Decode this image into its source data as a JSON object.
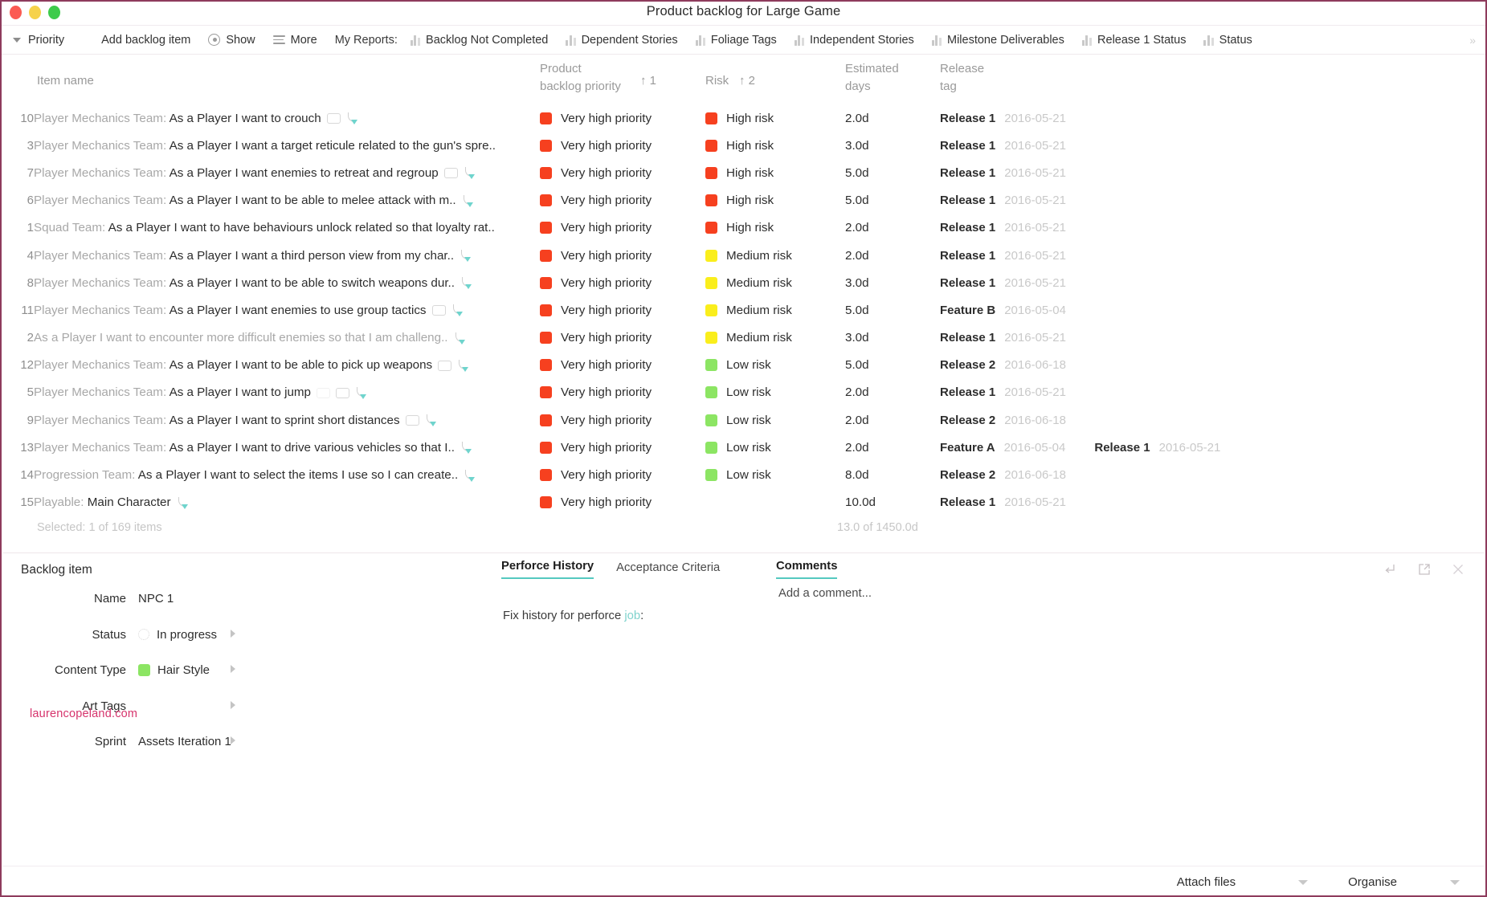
{
  "window": {
    "title": "Product backlog for Large Game",
    "traffic_lights": [
      "close",
      "minimize",
      "zoom"
    ]
  },
  "toolbar": {
    "priority": "Priority",
    "add_backlog_item": "Add backlog item",
    "show": "Show",
    "more": "More",
    "my_reports_label": "My Reports:",
    "reports": [
      "Backlog Not Completed",
      "Dependent Stories",
      "Foliage Tags",
      "Independent Stories",
      "Milestone Deliverables",
      "Release 1 Status",
      "Status"
    ]
  },
  "columns": {
    "item_name": "Item name",
    "priority_l1": "Product",
    "priority_l2": "backlog priority",
    "priority_sort": "↑ 1",
    "risk": "Risk",
    "risk_sort": "↑ 2",
    "days_l1": "Estimated",
    "days_l2": "days",
    "tag_l1": "Release",
    "tag_l2": "tag"
  },
  "rows": [
    {
      "idx": "10",
      "team": "Player Mechanics Team:",
      "story": "As a Player I want to crouch",
      "dim": false,
      "icons": [
        "note",
        "curve"
      ],
      "priority": "Very high priority",
      "priority_color": "#f6401f",
      "risk": "High risk",
      "risk_color": "#f6401f",
      "days": "2.0d",
      "tags": [
        {
          "name": "Release 1",
          "date": "2016-05-21"
        }
      ]
    },
    {
      "idx": "3",
      "team": "Player Mechanics Team:",
      "story": "As a Player I want a target reticule related to the gun's spre..",
      "dim": false,
      "icons": [],
      "priority": "Very high priority",
      "priority_color": "#f6401f",
      "risk": "High risk",
      "risk_color": "#f6401f",
      "days": "3.0d",
      "tags": [
        {
          "name": "Release 1",
          "date": "2016-05-21"
        }
      ]
    },
    {
      "idx": "7",
      "team": "Player Mechanics Team:",
      "story": "As a Player I want enemies to retreat and regroup",
      "dim": false,
      "icons": [
        "note",
        "curve"
      ],
      "priority": "Very high priority",
      "priority_color": "#f6401f",
      "risk": "High risk",
      "risk_color": "#f6401f",
      "days": "5.0d",
      "tags": [
        {
          "name": "Release 1",
          "date": "2016-05-21"
        }
      ]
    },
    {
      "idx": "6",
      "team": "Player Mechanics Team:",
      "story": "As a Player I want to be able to melee attack with m..",
      "dim": false,
      "icons": [
        "curve"
      ],
      "priority": "Very high priority",
      "priority_color": "#f6401f",
      "risk": "High risk",
      "risk_color": "#f6401f",
      "days": "5.0d",
      "tags": [
        {
          "name": "Release 1",
          "date": "2016-05-21"
        }
      ]
    },
    {
      "idx": "1",
      "team": "Squad Team:",
      "story": "As a Player I want to have behaviours unlock related so that loyalty rat..",
      "dim": false,
      "icons": [],
      "priority": "Very high priority",
      "priority_color": "#f6401f",
      "risk": "High risk",
      "risk_color": "#f6401f",
      "days": "2.0d",
      "tags": [
        {
          "name": "Release 1",
          "date": "2016-05-21"
        }
      ]
    },
    {
      "idx": "4",
      "team": "Player Mechanics Team:",
      "story": "As a Player I want a third person view from my char..",
      "dim": false,
      "icons": [
        "curve"
      ],
      "priority": "Very high priority",
      "priority_color": "#f6401f",
      "risk": "Medium risk",
      "risk_color": "#faee1c",
      "days": "2.0d",
      "tags": [
        {
          "name": "Release 1",
          "date": "2016-05-21"
        }
      ]
    },
    {
      "idx": "8",
      "team": "Player Mechanics Team:",
      "story": "As a Player I want to be able to switch weapons dur..",
      "dim": false,
      "icons": [
        "curve"
      ],
      "priority": "Very high priority",
      "priority_color": "#f6401f",
      "risk": "Medium risk",
      "risk_color": "#faee1c",
      "days": "3.0d",
      "tags": [
        {
          "name": "Release 1",
          "date": "2016-05-21"
        }
      ]
    },
    {
      "idx": "11",
      "team": "Player Mechanics Team:",
      "story": "As a Player I want enemies to use group tactics",
      "dim": false,
      "icons": [
        "note",
        "curve"
      ],
      "priority": "Very high priority",
      "priority_color": "#f6401f",
      "risk": "Medium risk",
      "risk_color": "#faee1c",
      "days": "5.0d",
      "tags": [
        {
          "name": "Feature B",
          "date": "2016-05-04"
        }
      ]
    },
    {
      "idx": "2",
      "team": "",
      "story": "As a Player I want to encounter more difficult enemies so that I am challeng..",
      "dim": true,
      "icons": [
        "curve"
      ],
      "priority": "Very high priority",
      "priority_color": "#f6401f",
      "risk": "Medium risk",
      "risk_color": "#faee1c",
      "days": "3.0d",
      "tags": [
        {
          "name": "Release 1",
          "date": "2016-05-21"
        }
      ]
    },
    {
      "idx": "12",
      "team": "Player Mechanics Team:",
      "story": "As a Player I want to be able to pick up weapons",
      "dim": false,
      "icons": [
        "note",
        "curve"
      ],
      "priority": "Very high priority",
      "priority_color": "#f6401f",
      "risk": "Low risk",
      "risk_color": "#8ce563",
      "days": "5.0d",
      "tags": [
        {
          "name": "Release 2",
          "date": "2016-06-18"
        }
      ]
    },
    {
      "idx": "5",
      "team": "Player Mechanics Team:",
      "story": "As a Player I want to jump",
      "dim": false,
      "icons": [
        "faint",
        "note",
        "curve"
      ],
      "priority": "Very high priority",
      "priority_color": "#f6401f",
      "risk": "Low risk",
      "risk_color": "#8ce563",
      "days": "2.0d",
      "tags": [
        {
          "name": "Release 1",
          "date": "2016-05-21"
        }
      ]
    },
    {
      "idx": "9",
      "team": "Player Mechanics Team:",
      "story": "As a Player I want to sprint short distances",
      "dim": false,
      "icons": [
        "note",
        "curve"
      ],
      "priority": "Very high priority",
      "priority_color": "#f6401f",
      "risk": "Low risk",
      "risk_color": "#8ce563",
      "days": "2.0d",
      "tags": [
        {
          "name": "Release 2",
          "date": "2016-06-18"
        }
      ]
    },
    {
      "idx": "13",
      "team": "Player Mechanics Team:",
      "story": "As a Player I want to drive various vehicles so that I..",
      "dim": false,
      "icons": [
        "curve"
      ],
      "priority": "Very high priority",
      "priority_color": "#f6401f",
      "risk": "Low risk",
      "risk_color": "#8ce563",
      "days": "2.0d",
      "tags": [
        {
          "name": "Feature A",
          "date": "2016-05-04"
        },
        {
          "name": "Release 1",
          "date": "2016-05-21"
        }
      ]
    },
    {
      "idx": "14",
      "team": "Progression Team:",
      "story": "As a Player I want to select the items I use so I can create..",
      "dim": false,
      "icons": [
        "curve"
      ],
      "priority": "Very high priority",
      "priority_color": "#f6401f",
      "risk": "Low risk",
      "risk_color": "#8ce563",
      "days": "8.0d",
      "tags": [
        {
          "name": "Release 2",
          "date": "2016-06-18"
        }
      ]
    },
    {
      "idx": "15",
      "team": "Playable:",
      "story": "Main Character",
      "dim": false,
      "icons": [
        "curve"
      ],
      "priority": "Very high priority",
      "priority_color": "#f6401f",
      "risk": "",
      "risk_color": "",
      "days": "10.0d",
      "tags": [
        {
          "name": "Release 1",
          "date": "2016-05-21"
        }
      ]
    }
  ],
  "status_bar": {
    "selected": "Selected: 1 of 169 items",
    "days_total": "13.0 of 1450.0d"
  },
  "detail": {
    "title": "Backlog item",
    "fields": [
      {
        "label": "Name",
        "value": "NPC 1",
        "caret": false,
        "marker": "none",
        "marker_color": ""
      },
      {
        "label": "Status",
        "value": "In progress",
        "caret": true,
        "marker": "spinner",
        "marker_color": ""
      },
      {
        "label": "Content Type",
        "value": "Hair Style",
        "caret": true,
        "marker": "swatch",
        "marker_color": "#8ce563"
      },
      {
        "label": "Art Tags",
        "value": "",
        "caret": true,
        "marker": "none",
        "marker_color": ""
      },
      {
        "label": "Sprint",
        "value": "Assets Iteration 1",
        "caret": true,
        "marker": "none",
        "marker_color": ""
      }
    ],
    "tabs": [
      {
        "label": "Perforce History",
        "active": true
      },
      {
        "label": "Acceptance Criteria",
        "active": false
      }
    ],
    "comments_label": "Comments",
    "comment_placeholder": "Add a comment...",
    "history_prefix": "Fix history for perforce ",
    "history_link": "job",
    "history_suffix": ":",
    "panel_icons": [
      "return-arrow-icon",
      "open-external-icon",
      "close-icon"
    ],
    "actions": [
      {
        "label": "Attach files"
      },
      {
        "label": "Organise"
      }
    ]
  },
  "watermark": "laurencopeland.com"
}
